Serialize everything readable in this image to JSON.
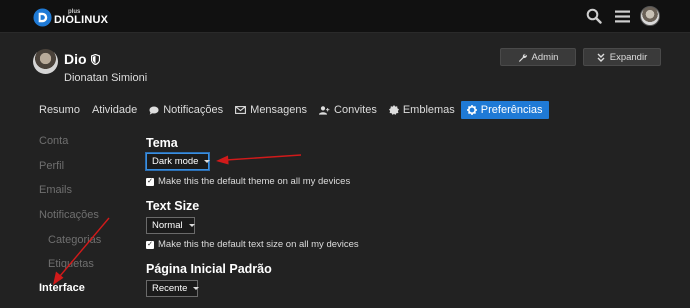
{
  "site": {
    "logo_small": "plus",
    "logo_big": "DIOLINUX",
    "logo_icon": "d-logo-icon"
  },
  "topbar": {
    "icons": [
      "search-icon",
      "menu-icon",
      "user-avatar"
    ]
  },
  "profile": {
    "username": "Dio",
    "full_name": "Dionatan Simioni",
    "badge_icon": "shield-icon"
  },
  "actions": {
    "admin_label": "Admin",
    "expand_label": "Expandir"
  },
  "tabs": [
    {
      "label": "Resumo",
      "icon": ""
    },
    {
      "label": "Atividade",
      "icon": ""
    },
    {
      "label": "Notificações",
      "icon": "chat-bubble-icon"
    },
    {
      "label": "Mensagens",
      "icon": "envelope-icon"
    },
    {
      "label": "Convites",
      "icon": "user-plus-icon"
    },
    {
      "label": "Emblemas",
      "icon": "certificate-icon"
    },
    {
      "label": "Preferências",
      "icon": "gear-icon",
      "active": true
    }
  ],
  "sidebar": {
    "items": [
      {
        "label": "Conta"
      },
      {
        "label": "Perfil"
      },
      {
        "label": "Emails"
      },
      {
        "label": "Notificações"
      },
      {
        "label": "Categorias",
        "sub": true
      },
      {
        "label": "Etiquetas",
        "sub": true
      },
      {
        "label": "Interface",
        "active": true
      }
    ]
  },
  "settings": {
    "theme": {
      "title": "Tema",
      "value": "Dark mode",
      "checkbox_label": "Make this the default theme on all my devices",
      "checked": true
    },
    "text_size": {
      "title": "Text Size",
      "value": "Normal",
      "checkbox_label": "Make this the default text size on all my devices",
      "checked": true
    },
    "homepage": {
      "title": "Página Inicial Padrão",
      "value": "Recente"
    }
  },
  "colors": {
    "accent": "#1f7ad6",
    "annotation": "#d11a1a",
    "background": "#222222",
    "header": "#111111"
  }
}
